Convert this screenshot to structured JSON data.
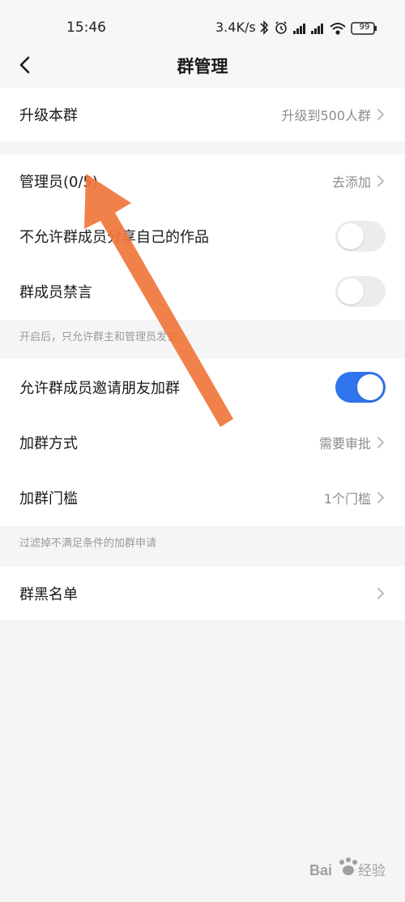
{
  "status": {
    "time": "15:46",
    "network_speed": "3.4K/s",
    "battery": "99"
  },
  "header": {
    "title": "群管理"
  },
  "upgrade": {
    "label": "升级本群",
    "value": "升级到500人群"
  },
  "admin": {
    "label": "管理员(0/5)",
    "value": "去添加"
  },
  "no_share": {
    "label": "不允许群成员分享自己的作品",
    "enabled": false
  },
  "mute": {
    "label": "群成员禁言",
    "enabled": false,
    "note": "开启后，只允许群主和管理员发言。"
  },
  "invite": {
    "label": "允许群成员邀请朋友加群",
    "enabled": true
  },
  "join_method": {
    "label": "加群方式",
    "value": "需要审批"
  },
  "join_threshold": {
    "label": "加群门槛",
    "value": "1个门槛",
    "note": "过滤掉不满足条件的加群申请"
  },
  "blacklist": {
    "label": "群黑名单"
  },
  "colors": {
    "accent": "#2f74ec",
    "annotation_arrow": "#f0763c"
  },
  "watermark": {
    "text": "Baidu经验",
    "url": "jingyan.baidu.com"
  }
}
